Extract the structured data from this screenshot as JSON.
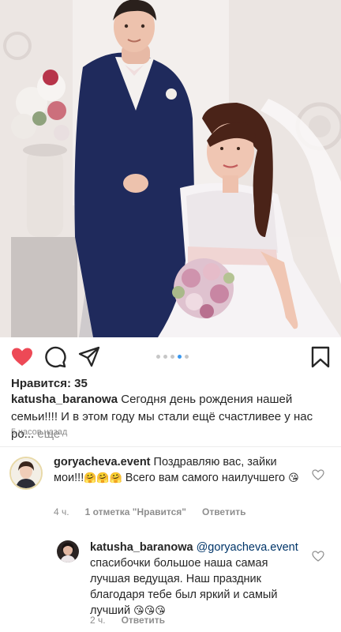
{
  "post": {
    "likes_text": "Нравится: 35",
    "caption_user": "katusha_baranowa",
    "caption_text": " Сегодня день рождения нашей семьи!!!! И в этом году мы стали ещё счастливее у нас ро...",
    "caption_more": " еще",
    "time_ago": "5 часов назад",
    "carousel": {
      "count": 5,
      "active_index": 3
    }
  },
  "icons": {
    "like": "heart-filled-icon",
    "comment": "comment-bubble-icon",
    "share": "paper-plane-icon",
    "save": "bookmark-icon"
  },
  "colors": {
    "like": "#ed4956",
    "accent": "#3897f0",
    "mention": "#003569",
    "muted": "#8e8e8e"
  },
  "comments": [
    {
      "user": "goryacheva.event",
      "text": " Поздравляю вас, зайки мои!!!",
      "emoji1": "🤗🤗🤗",
      "text2": " Всего вам самого наилучшего ",
      "emoji2": "😘",
      "time": "4 ч.",
      "likes": "1 отметка \"Нравится\"",
      "reply": "Ответить"
    },
    {
      "user": "katusha_baranowa",
      "mention": " @goryacheva.event",
      "text": " спасибочки большое наша самая лучшая ведущая. Наш праздник благодаря тебе был яркий и самый лучший ",
      "emoji": "😘😘😘",
      "time": "2 ч.",
      "reply": "Ответить"
    }
  ]
}
